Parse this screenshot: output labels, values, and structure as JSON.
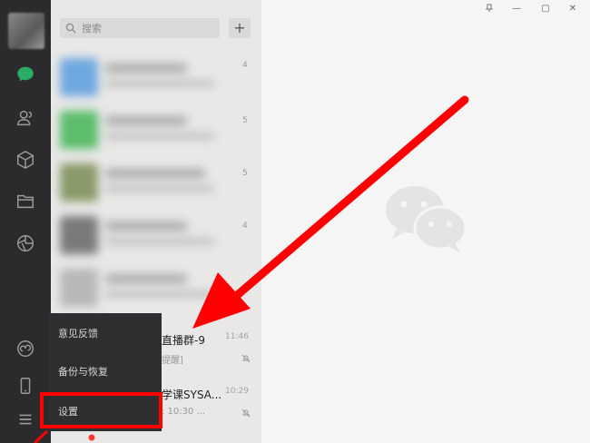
{
  "window": {
    "controls": {
      "pin": "pin-icon",
      "minimize": "—",
      "maximize": "▢",
      "close": "✕"
    }
  },
  "sidebar": {
    "icons": [
      "chat-icon",
      "contacts-icon",
      "favorites-icon",
      "files-icon",
      "moments-icon",
      "miniprogram-icon",
      "phone-icon",
      "menu-icon"
    ]
  },
  "chat_list": {
    "search_placeholder": "搜索",
    "add_label": "+",
    "blurred_times": [
      "4",
      "5",
      "5",
      "4"
    ],
    "rows": [
      {
        "name": "直播群-9",
        "preview": "提醒]",
        "time": "11:46"
      },
      {
        "name": "学课SYSA...",
        "preview": ": 10:30 ...",
        "time": "10:29"
      }
    ]
  },
  "menu": {
    "items": [
      "意见反馈",
      "备份与恢复",
      "设置"
    ]
  },
  "colors": {
    "accent_green": "#2aae67",
    "annotation_red": "#ff0000"
  }
}
